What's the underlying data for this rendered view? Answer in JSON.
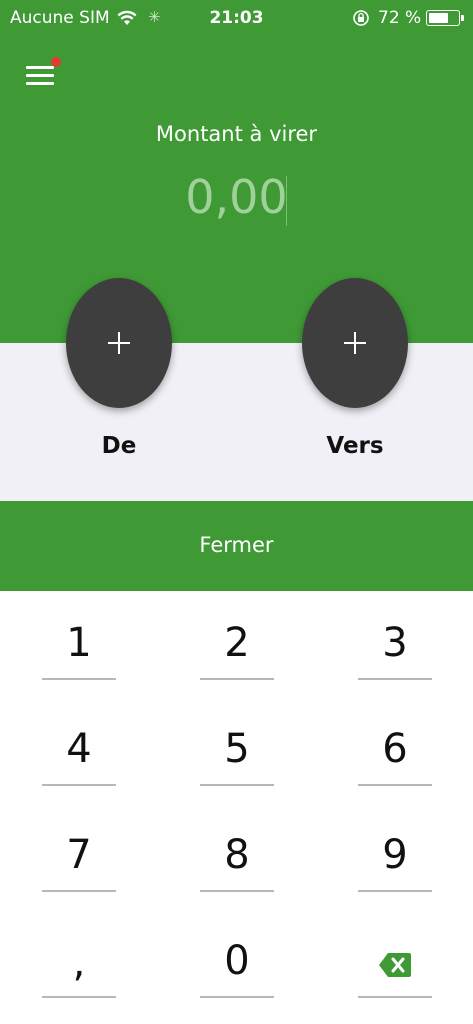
{
  "status_bar": {
    "carrier": "Aucune SIM",
    "time": "21:03",
    "battery": "72 %",
    "battery_level": 0.72
  },
  "header": {
    "menu_icon": "hamburger-icon",
    "notification_dot_color": "#e53935",
    "amount_label": "Montant à virer",
    "amount_value": "0,00"
  },
  "accounts": {
    "from_label": "De",
    "to_label": "Vers",
    "add_icon": "plus-icon"
  },
  "close_button": {
    "label": "Fermer"
  },
  "keypad": {
    "keys": [
      "1",
      "2",
      "3",
      "4",
      "5",
      "6",
      "7",
      "8",
      "9",
      ",",
      "0"
    ],
    "backspace_icon": "backspace-icon"
  },
  "colors": {
    "primary_green": "#3f9a36",
    "fab_dark": "#3e3e3e",
    "panel_gray": "#f0f0f6"
  }
}
